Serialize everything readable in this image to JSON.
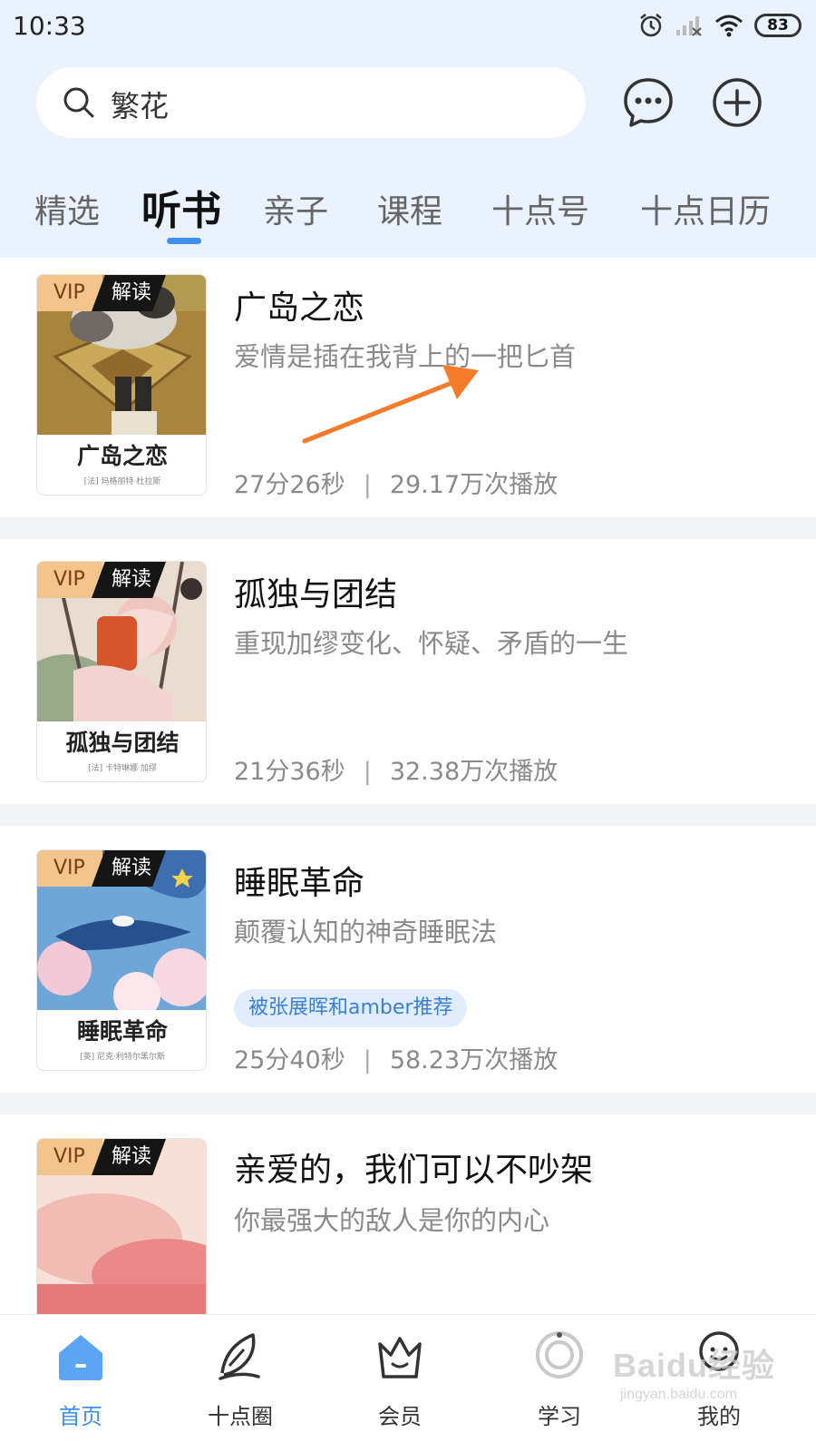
{
  "status": {
    "time": "10:33",
    "battery": "83"
  },
  "search": {
    "value": "繁花"
  },
  "tabs": [
    "精选",
    "听书",
    "亲子",
    "课程",
    "十点号",
    "十点日历"
  ],
  "active_tab": "听书",
  "books": [
    {
      "title": "广岛之恋",
      "subtitle": "爱情是插在我背上的一把匕首",
      "duration": "27分26秒",
      "plays": "29.17万次播放",
      "cover_title": "广岛之恋",
      "cover_author": "[法] 玛格丽特·杜拉斯",
      "badge_vip": "VIP",
      "badge_tag": "解读"
    },
    {
      "title": "孤独与团结",
      "subtitle": "重现加缪变化、怀疑、矛盾的一生",
      "duration": "21分36秒",
      "plays": "32.38万次播放",
      "cover_title": "孤独与团结",
      "cover_author": "[法] 卡特琳娜·加缪",
      "badge_vip": "VIP",
      "badge_tag": "解读"
    },
    {
      "title": "睡眠革命",
      "subtitle": "颠覆认知的神奇睡眠法",
      "recommend": "被张展晖和amber推荐",
      "duration": "25分40秒",
      "plays": "58.23万次播放",
      "cover_title": "睡眠革命",
      "cover_author": "[英] 尼克·利特尔黑尔斯",
      "badge_vip": "VIP",
      "badge_tag": "解读"
    },
    {
      "title": "亲爱的，我们可以不吵架",
      "subtitle": "你最强大的敌人是你的内心",
      "badge_vip": "VIP",
      "badge_tag": "解读"
    }
  ],
  "meta_separator": "|",
  "bottom_nav": [
    {
      "label": "首页",
      "icon": "home-icon",
      "active": true
    },
    {
      "label": "十点圈",
      "icon": "feather-icon",
      "active": false
    },
    {
      "label": "会员",
      "icon": "crown-icon",
      "active": false
    },
    {
      "label": "学习",
      "icon": "study-icon",
      "active": false
    },
    {
      "label": "我的",
      "icon": "profile-icon",
      "active": false
    }
  ],
  "watermark": {
    "main": "Baidu经验",
    "sub": "jingyan.baidu.com"
  },
  "colors": {
    "accent": "#3f8ff1",
    "header_bg": "#eaf2fd",
    "vip_badge": "#f3c58d",
    "annotation_arrow": "#f47b2a"
  }
}
